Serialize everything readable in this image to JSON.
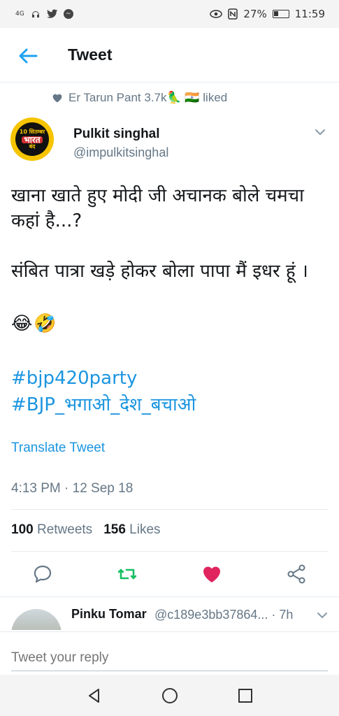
{
  "status_bar": {
    "network": "4G",
    "battery": "27%",
    "time": "11:59"
  },
  "header": {
    "title": "Tweet"
  },
  "social_context": {
    "text": "Er Tarun Pant 3.7k🦜 🇮🇳 liked"
  },
  "tweet": {
    "author_name": "Pulkit  singhal",
    "author_handle": "@impulkitsinghal",
    "avatar_text_top": "10 सितम्बर",
    "avatar_text_mid": "भारत",
    "avatar_text_bottom": "बंद",
    "text": "खाना खाते हुए मोदी जी अचानक बोले चमचा कहां है...?\n\nसंबित पात्रा खड़े होकर बोला पापा मैं इधर हूं ।",
    "emoji_1": "😂",
    "emoji_2": "🤣",
    "hashtags": [
      "#bjp420party",
      "#BJP_भगाओ_देश_बचाओ"
    ],
    "translate_label": "Translate Tweet",
    "timestamp": "4:13 PM · 12 Sep 18",
    "retweets_count": "100",
    "retweets_label": "Retweets",
    "likes_count": "156",
    "likes_label": "Likes"
  },
  "reply": {
    "name": "Pinku Tomar",
    "meta": "@c189e3bb37864... · 7h"
  },
  "compose": {
    "placeholder": "Tweet your reply"
  },
  "colors": {
    "accent": "#1da1f2",
    "link": "#1b95e0",
    "retweet": "#17bf63",
    "like": "#e0245e",
    "muted": "#657786"
  }
}
